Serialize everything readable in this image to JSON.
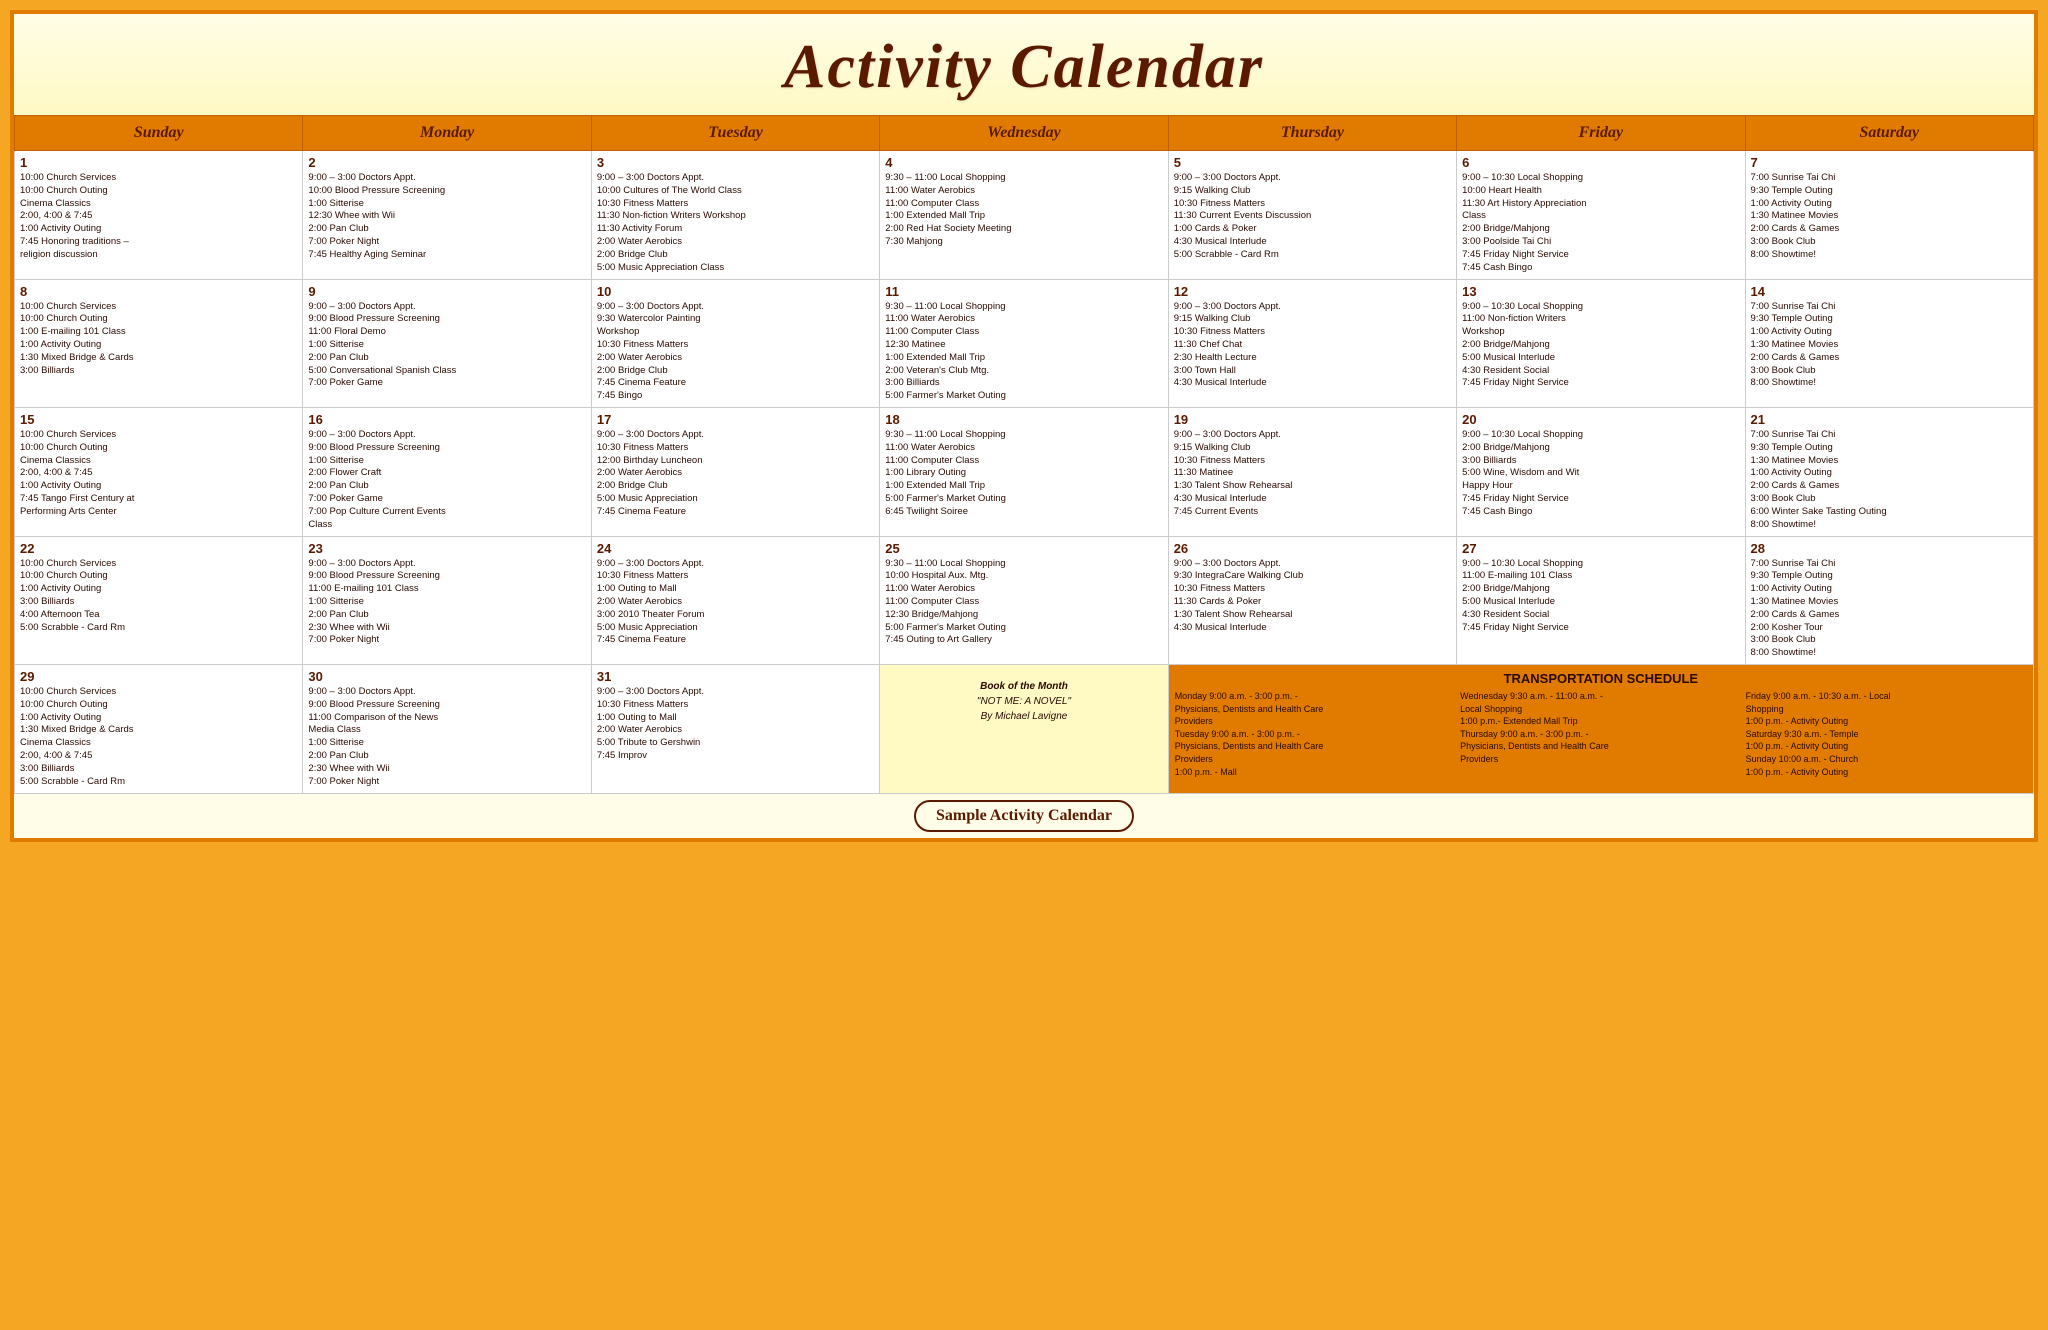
{
  "title": "Activity Calendar",
  "footer": "Sample Activity Calendar",
  "days_of_week": [
    "Sunday",
    "Monday",
    "Tuesday",
    "Wednesday",
    "Thursday",
    "Friday",
    "Saturday"
  ],
  "weeks": [
    [
      {
        "day": 1,
        "events": [
          "10:00 Church Services",
          "10:00 Church Outing",
          "Cinema Classics",
          "2:00, 4:00 & 7:45",
          "1:00  Activity Outing",
          "7:45 Honoring traditions –",
          "religion discussion"
        ]
      },
      {
        "day": 2,
        "events": [
          "9:00 – 3:00 Doctors Appt.",
          "10:00 Blood Pressure Screening",
          "1:00 Sitterise",
          "12:30 Whee with Wii",
          "2:00 Pan Club",
          "7:00 Poker Night",
          "7:45 Healthy Aging Seminar"
        ]
      },
      {
        "day": 3,
        "events": [
          "9:00 – 3:00 Doctors Appt.",
          "10:00 Cultures of The World Class",
          "10:30 Fitness Matters",
          "11:30 Non-fiction Writers Workshop",
          "11:30 Activity Forum",
          "2:00 Water Aerobics",
          "2:00 Bridge Club",
          "5:00 Music Appreciation Class"
        ]
      },
      {
        "day": 4,
        "events": [
          "9:30 – 11:00 Local Shopping",
          "11:00 Water Aerobics",
          "11:00 Computer Class",
          "1:00 Extended Mall Trip",
          "2:00 Red Hat Society Meeting",
          "7:30 Mahjong"
        ]
      },
      {
        "day": 5,
        "events": [
          "9:00 – 3:00 Doctors Appt.",
          "9:15 Walking Club",
          "10:30 Fitness Matters",
          "11:30 Current Events Discussion",
          "1:00 Cards & Poker",
          "4:30 Musical Interlude",
          "5:00 Scrabble - Card Rm"
        ]
      },
      {
        "day": 6,
        "events": [
          "9:00 – 10:30 Local Shopping",
          "10:00 Heart Health",
          "11:30 Art History Appreciation",
          "Class",
          "2:00 Bridge/Mahjong",
          "3:00 Poolside Tai Chi",
          "7:45 Friday Night Service",
          "7:45 Cash Bingo"
        ]
      },
      {
        "day": 7,
        "events": [
          "7:00 Sunrise Tai Chi",
          "9:30  Temple Outing",
          "1:00  Activity Outing",
          "1:30 Matinee Movies",
          "2:00 Cards & Games",
          "3:00 Book Club",
          "8:00 Showtime!"
        ]
      }
    ],
    [
      {
        "day": 8,
        "events": [
          "10:00 Church Services",
          "10:00 Church Outing",
          "1:00 E-mailing 101 Class",
          "1:00  Activity Outing",
          "1:30 Mixed Bridge & Cards",
          "3:00 Billiards"
        ]
      },
      {
        "day": 9,
        "events": [
          "9:00 – 3:00 Doctors Appt.",
          "9:00 Blood Pressure Screening",
          "11:00 Floral Demo",
          "1:00 Sitterise",
          "2:00 Pan Club",
          "5:00 Conversational Spanish Class",
          "7:00 Poker Game"
        ]
      },
      {
        "day": 10,
        "events": [
          "9:00 – 3:00 Doctors Appt.",
          "9:30 Watercolor Painting",
          "Workshop",
          "10:30 Fitness Matters",
          "2:00 Water Aerobics",
          "2:00 Bridge Club",
          "7:45 Cinema Feature",
          "7:45 Bingo"
        ]
      },
      {
        "day": 11,
        "events": [
          "9:30 – 11:00 Local Shopping",
          "11:00 Water Aerobics",
          "11:00 Computer Class",
          "12:30 Matinee",
          "1:00 Extended Mall Trip",
          "2:00 Veteran's Club Mtg.",
          "3:00 Billiards",
          "5:00 Farmer's Market Outing"
        ]
      },
      {
        "day": 12,
        "events": [
          "9:00 – 3:00 Doctors Appt.",
          "9:15 Walking Club",
          "10:30 Fitness Matters",
          "11:30 Chef Chat",
          "2:30 Health Lecture",
          "3:00 Town Hall",
          "4:30 Musical Interlude"
        ]
      },
      {
        "day": 13,
        "events": [
          "9:00 – 10:30 Local Shopping",
          "11:00 Non-fiction Writers",
          "Workshop",
          "2:00 Bridge/Mahjong",
          "5:00 Musical Interlude",
          "4:30 Resident Social",
          "7:45 Friday Night Service"
        ]
      },
      {
        "day": 14,
        "events": [
          "7:00 Sunrise Tai Chi",
          "9:30  Temple Outing",
          "1:00  Activity Outing",
          "1:30 Matinee Movies",
          "2:00 Cards & Games",
          "3:00 Book Club",
          "8:00 Showtime!"
        ]
      }
    ],
    [
      {
        "day": 15,
        "events": [
          "10:00 Church Services",
          "10:00 Church Outing",
          "Cinema Classics",
          "2:00, 4:00 & 7:45",
          "1:00  Activity Outing",
          "7:45 Tango First Century at",
          "Performing Arts Center"
        ]
      },
      {
        "day": 16,
        "events": [
          "9:00 – 3:00 Doctors Appt.",
          "9:00 Blood Pressure Screening",
          "1:00 Sitterise",
          "2:00 Flower Craft",
          "2:00 Pan Club",
          "7:00 Poker Game",
          "7:00 Pop Culture Current Events",
          "Class"
        ]
      },
      {
        "day": 17,
        "events": [
          "9:00 – 3:00 Doctors Appt.",
          "10:30 Fitness Matters",
          "12:00 Birthday Luncheon",
          "2:00 Water Aerobics",
          "2:00 Bridge Club",
          "5:00 Music Appreciation",
          "7:45 Cinema Feature"
        ]
      },
      {
        "day": 18,
        "events": [
          "9:30 – 11:00 Local Shopping",
          "11:00 Water Aerobics",
          "11:00 Computer Class",
          "1:00 Library Outing",
          "1:00 Extended Mall Trip",
          "5:00 Farmer's Market Outing",
          "6:45 Twilight Soiree"
        ]
      },
      {
        "day": 19,
        "events": [
          "9:00 – 3:00 Doctors Appt.",
          "9:15 Walking Club",
          "10:30 Fitness Matters",
          "11:30 Matinee",
          "1:30 Talent Show Rehearsal",
          "4:30 Musical Interlude",
          "7:45 Current Events"
        ]
      },
      {
        "day": 20,
        "events": [
          "9:00 – 10:30 Local Shopping",
          "2:00 Bridge/Mahjong",
          "3:00 Billiards",
          "5:00 Wine, Wisdom and Wit",
          "Happy Hour",
          "7:45 Friday Night Service",
          "7:45 Cash Bingo"
        ]
      },
      {
        "day": 21,
        "events": [
          "7:00 Sunrise Tai Chi",
          "9:30  Temple Outing",
          "1:30 Matinee Movies",
          "1:00  Activity Outing",
          "2:00 Cards & Games",
          "3:00 Book Club",
          "6:00 Winter Sake Tasting Outing",
          "8:00 Showtime!"
        ]
      }
    ],
    [
      {
        "day": 22,
        "events": [
          "10:00 Church Services",
          "10:00 Church Outing",
          "1:00  Activity Outing",
          "3:00 Billiards",
          "4:00 Afternoon Tea",
          "5:00 Scrabble - Card Rm"
        ]
      },
      {
        "day": 23,
        "events": [
          "9:00 – 3:00 Doctors Appt.",
          "9:00 Blood Pressure Screening",
          "11:00 E-mailing 101 Class",
          "1:00 Sitterise",
          "2:00 Pan Club",
          "2:30 Whee with Wii",
          "7:00 Poker Night"
        ]
      },
      {
        "day": 24,
        "events": [
          "9:00 – 3:00 Doctors Appt.",
          "10:30 Fitness Matters",
          "1:00 Outing to Mall",
          "2:00 Water Aerobics",
          "3:00 2010 Theater Forum",
          "5:00 Music Appreciation",
          "7:45 Cinema Feature"
        ]
      },
      {
        "day": 25,
        "events": [
          "9:30 – 11:00 Local Shopping",
          "10:00 Hospital Aux. Mtg.",
          "11:00 Water Aerobics",
          "11:00 Computer Class",
          "12:30 Bridge/Mahjong",
          "5:00 Farmer's Market Outing",
          "7:45 Outing to Art Gallery"
        ]
      },
      {
        "day": 26,
        "events": [
          "9:00 – 3:00 Doctors Appt.",
          "9:30 IntegraCare Walking Club",
          "10:30 Fitness Matters",
          "11:30 Cards & Poker",
          "1:30 Talent Show Rehearsal",
          "4:30 Musical Interlude"
        ]
      },
      {
        "day": 27,
        "events": [
          "9:00 – 10:30 Local Shopping",
          "11:00 E-mailing 101 Class",
          "2:00 Bridge/Mahjong",
          "5:00 Musical Interlude",
          "4:30 Resident Social",
          "7:45 Friday Night Service"
        ]
      },
      {
        "day": 28,
        "events": [
          "7:00 Sunrise Tai Chi",
          "9:30  Temple Outing",
          "1:00  Activity Outing",
          "1:30 Matinee Movies",
          "2:00 Cards & Games",
          "2:00 Kosher Tour",
          "3:00 Book Club",
          "8:00 Showtime!"
        ]
      }
    ],
    [
      {
        "day": 29,
        "events": [
          "10:00 Church Services",
          "10:00 Church Outing",
          "1:00  Activity Outing",
          "1:30 Mixed Bridge & Cards",
          "Cinema Classics",
          "2:00, 4:00 & 7:45",
          "3:00 Billiards",
          "5:00 Scrabble - Card Rm"
        ]
      },
      {
        "day": 30,
        "events": [
          "9:00 – 3:00 Doctors Appt.",
          "9:00 Blood Pressure Screening",
          "11:00 Comparison of the News",
          "Media Class",
          "1:00 Sitterise",
          "2:00 Pan Club",
          "2:30 Whee with Wii",
          "7:00 Poker Night"
        ]
      },
      {
        "day": 31,
        "events": [
          "9:00 – 3:00 Doctors Appt.",
          "10:30 Fitness Matters",
          "1:00 Outing to Mall",
          "2:00 Water Aerobics",
          "5:00 Tribute to Gershwin",
          "7:45 Improv"
        ]
      },
      {
        "special": "book",
        "book_title": "Book of the Month",
        "book_name": "\"NOT ME: A NOVEL\"",
        "book_author": "By Michael Lavigne"
      },
      {
        "special": "transport_placeholder"
      },
      {
        "special": "transport_placeholder"
      },
      {
        "special": "transport_placeholder"
      }
    ]
  ],
  "transport": {
    "title": "TRANSPORTATION SCHEDULE",
    "col1": {
      "lines": [
        "Monday 9:00 a.m. - 3:00 p.m. -",
        "Physicians, Dentists and Health Care",
        "Providers",
        "Tuesday 9:00 a.m. - 3:00 p.m. -",
        "Physicians, Dentists and Health Care",
        "Providers",
        "1:00 p.m. - Mall"
      ]
    },
    "col2": {
      "lines": [
        "Wednesday 9:30 a.m. - 11:00 a.m. -",
        "Local Shopping",
        "1:00 p.m.- Extended Mall Trip",
        "Thursday 9:00 a.m. - 3:00 p.m. -",
        "Physicians, Dentists and Health Care",
        "Providers"
      ]
    },
    "col3": {
      "lines": [
        "Friday 9:00 a.m. - 10:30 a.m. - Local",
        "Shopping",
        "1:00 p.m. - Activity Outing",
        "Saturday 9:30 a.m. - Temple",
        "1:00 p.m. - Activity Outing",
        "Sunday 10:00 a.m. - Church",
        "1:00 p.m. - Activity Outing"
      ]
    }
  }
}
